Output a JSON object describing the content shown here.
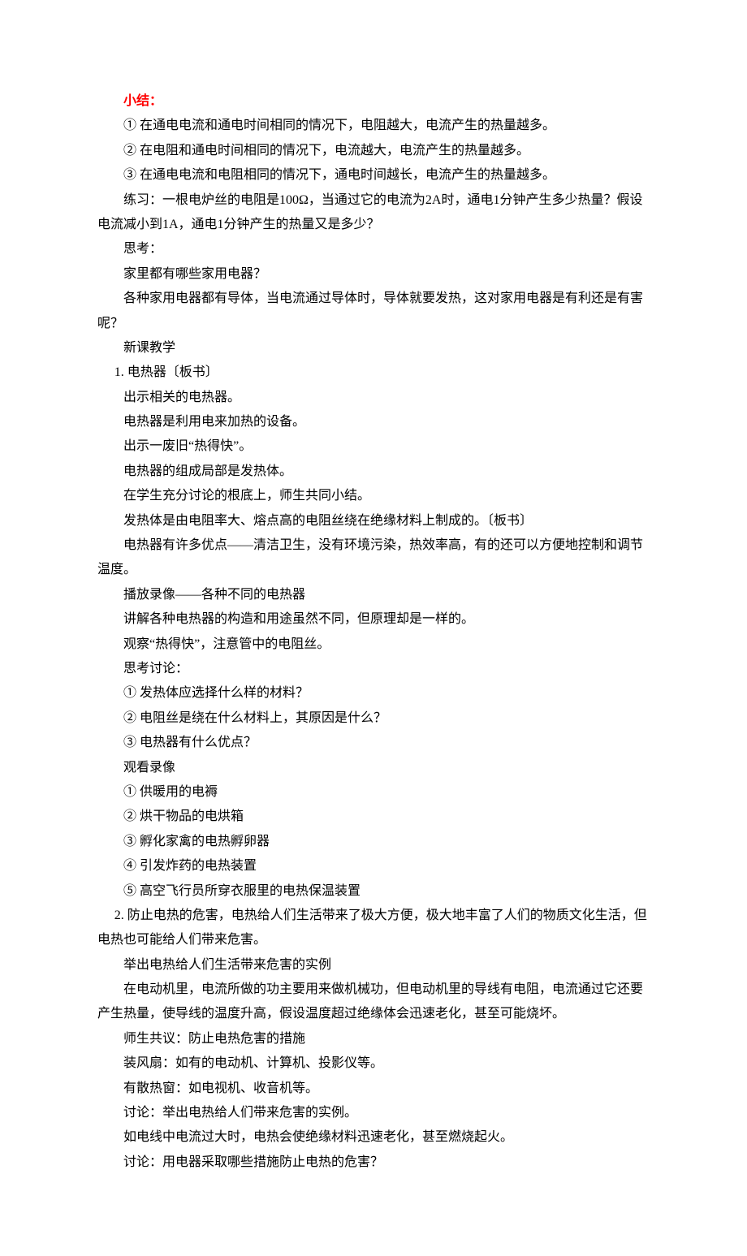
{
  "lines": [
    {
      "text": "小结：",
      "cls": "indent1 highlight"
    },
    {
      "text": "① 在通电电流和通电时间相同的情况下，电阻越大，电流产生的热量越多。",
      "cls": "indent1"
    },
    {
      "text": "② 在电阻和通电时间相同的情况下，电流越大，电流产生的热量越多。",
      "cls": "indent1"
    },
    {
      "text": "③ 在通电电流和电阻相同的情况下，通电时间越长，电流产生的热量越多。",
      "cls": "indent1"
    },
    {
      "text": "练习：一根电炉丝的电阻是100Ω，当通过它的电流为2A时，通电1分钟产生多少热量？假设电流减小到1A，通电1分钟产生的热量又是多少？",
      "cls": "indent1"
    },
    {
      "text": "思考：",
      "cls": "indent1"
    },
    {
      "text": "家里都有哪些家用电器？",
      "cls": "indent1"
    },
    {
      "text": "各种家用电器都有导体，当电流通过导体时，导体就要发热，这对家用电器是有利还是有害呢？",
      "cls": "indent1"
    },
    {
      "text": "新课教学",
      "cls": "indent1"
    },
    {
      "text": "1. 电热器〔板书〕",
      "cls": "indent-half"
    },
    {
      "text": "出示相关的电热器。",
      "cls": "indent1"
    },
    {
      "text": "电热器是利用电来加热的设备。",
      "cls": "indent1"
    },
    {
      "text": "出示一废旧“热得快”。",
      "cls": "indent1"
    },
    {
      "text": "电热器的组成局部是发热体。",
      "cls": "indent1"
    },
    {
      "text": "在学生充分讨论的根底上，师生共同小结。",
      "cls": "indent1"
    },
    {
      "text": "发热体是由电阻率大、熔点高的电阻丝绕在绝缘材料上制成的。〔板书〕",
      "cls": "indent1"
    },
    {
      "text": "电热器有许多优点——清洁卫生，没有环境污染，热效率高，有的还可以方便地控制和调节温度。",
      "cls": "indent1"
    },
    {
      "text": "播放录像——各种不同的电热器",
      "cls": "indent1"
    },
    {
      "text": "讲解各种电热器的构造和用途虽然不同，但原理却是一样的。",
      "cls": "indent1"
    },
    {
      "text": "观察“热得快”，注意管中的电阻丝。",
      "cls": "indent1"
    },
    {
      "text": "思考讨论：",
      "cls": "indent1"
    },
    {
      "text": "① 发热体应选择什么样的材料？",
      "cls": "indent1"
    },
    {
      "text": "② 电阻丝是绕在什么材料上，其原因是什么？",
      "cls": "indent1"
    },
    {
      "text": "③ 电热器有什么优点？",
      "cls": "indent1"
    },
    {
      "text": "观看录像",
      "cls": "indent1"
    },
    {
      "text": "① 供暖用的电褥",
      "cls": "indent1"
    },
    {
      "text": "② 烘干物品的电烘箱",
      "cls": "indent1"
    },
    {
      "text": "③ 孵化家禽的电热孵卵器",
      "cls": "indent1"
    },
    {
      "text": "④ 引发炸药的电热装置",
      "cls": "indent1"
    },
    {
      "text": "⑤ 高空飞行员所穿衣服里的电热保温装置",
      "cls": "indent1"
    },
    {
      "text": "2. 防止电热的危害，电热给人们生活带来了极大方便，极大地丰富了人们的物质文化生活，但电热也可能给人们带来危害。",
      "cls": "indent-half"
    },
    {
      "text": "举出电热给人们生活带来危害的实例",
      "cls": "indent1"
    },
    {
      "text": "在电动机里，电流所做的功主要用来做机械功，但电动机里的导线有电阻，电流通过它还要产生热量，使导线的温度升高，假设温度超过绝缘体会迅速老化，甚至可能烧坏。",
      "cls": "indent1"
    },
    {
      "text": "师生共议：防止电热危害的措施",
      "cls": "indent1"
    },
    {
      "text": "装风扇：如有的电动机、计算机、投影仪等。",
      "cls": "indent1"
    },
    {
      "text": "有散热窗：如电视机、收音机等。",
      "cls": "indent1"
    },
    {
      "text": "讨论：举出电热给人们带来危害的实例。",
      "cls": "indent1"
    },
    {
      "text": "如电线中电流过大时，电热会使绝缘材料迅速老化，甚至燃烧起火。",
      "cls": "indent1"
    },
    {
      "text": "讨论：用电器采取哪些措施防止电热的危害？",
      "cls": "indent1"
    }
  ]
}
